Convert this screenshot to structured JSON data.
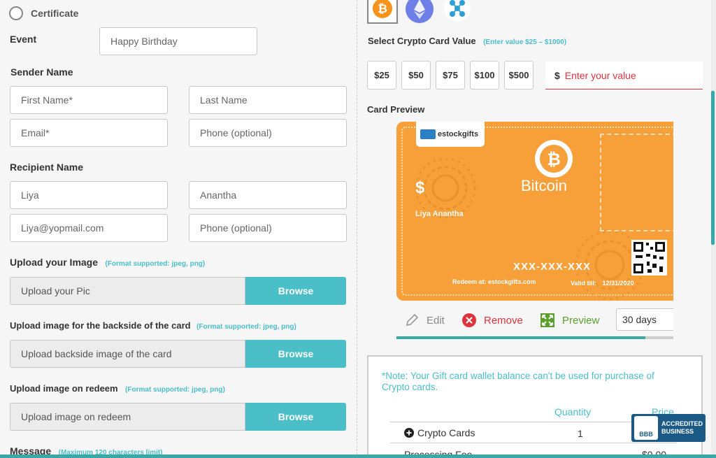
{
  "left": {
    "certificate_label": "Certificate",
    "event_label": "Event",
    "event_value": "Happy Birthday",
    "sender_heading": "Sender Name",
    "sender_first_placeholder": "First Name*",
    "sender_last_placeholder": "Last Name",
    "sender_email_placeholder": "Email*",
    "sender_phone_placeholder": "Phone (optional)",
    "recipient_heading": "Recipient Name",
    "recipient_first": "Liya",
    "recipient_last": "Anantha",
    "recipient_email": "Liya@yopmail.com",
    "recipient_phone_placeholder": "Phone (optional)",
    "upload_image_label": "Upload your Image",
    "upload_image_note": "(Format supported: jpeg, png)",
    "upload_image_placeholder": "Upload your Pic",
    "browse_label": "Browse",
    "upload_back_label": "Upload image for the backside of the card",
    "upload_back_note": "(Format supported: jpeg, png)",
    "upload_back_placeholder": "Upload backside image of the card",
    "upload_redeem_label": "Upload image on redeem",
    "upload_redeem_note": "(Format supported: jpeg, png)",
    "upload_redeem_placeholder": "Upload image on redeem",
    "message_label": "Message",
    "message_note": "(Maximum 120 characters limit)"
  },
  "right": {
    "coins": [
      "bitcoin-icon",
      "ethereum-icon",
      "ripple-icon"
    ],
    "value_label": "Select Crypto Card Value",
    "value_note": "(Enter value $25 – $1000)",
    "amounts": [
      "$25",
      "$50",
      "$75",
      "$100",
      "$500"
    ],
    "custom_currency": "$",
    "custom_placeholder": "Enter your value",
    "preview_label": "Card Preview",
    "card": {
      "brand": "estockgifts",
      "coin_name": "Bitcoin",
      "dollar": "$",
      "recipient": "Liya Anantha",
      "code": "XXX-XXX-XXX",
      "redeem": "Redeem at: estockgifts.com",
      "valid_label": "Valid till:",
      "valid_date": "12/31/2020",
      "color": "#f7a03a"
    },
    "edit_label": "Edit",
    "remove_label": "Remove",
    "preview_btn_label": "Preview",
    "validity_value": "30 days",
    "progress_fraction": 0.9,
    "note_text": "*Note: Your Gift card wallet balance can't be used for purchase of Crypto cards.",
    "table": {
      "col_quantity": "Quantity",
      "col_price": "Price",
      "row1_label": "Crypto Cards",
      "row1_qty": "1",
      "row2_label": "Processing Fee",
      "row2_price": "$0.00"
    },
    "bbb": {
      "logo": "BBB",
      "line1": "ACCREDITED",
      "line2": "BUSINESS"
    }
  },
  "colors": {
    "accent": "#4bbfc8",
    "error": "#e0323c",
    "orange": "#f7a03a",
    "green": "#5aa02c"
  }
}
